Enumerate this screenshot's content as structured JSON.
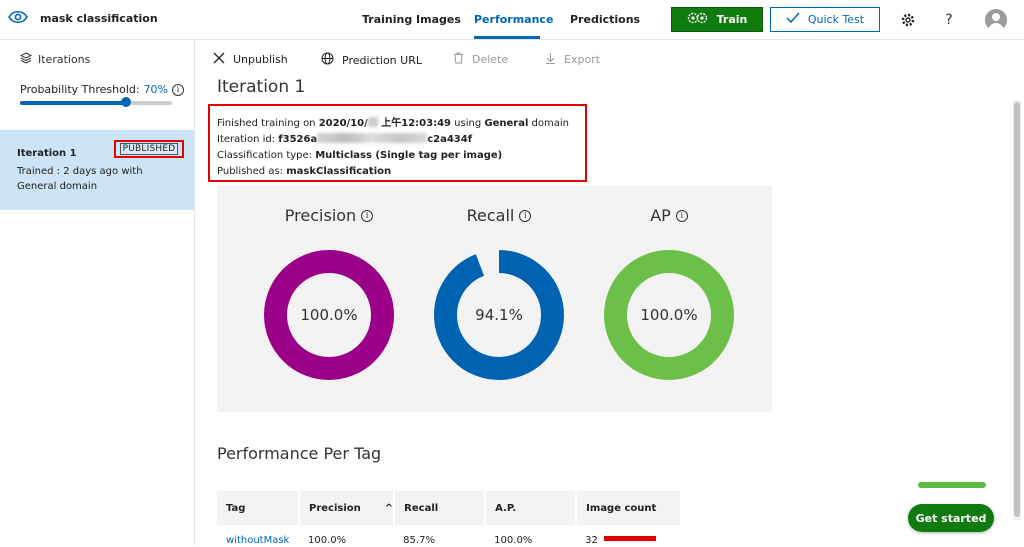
{
  "app": {
    "project_name": "mask classification"
  },
  "nav": {
    "tabs": [
      {
        "label": "Training Images"
      },
      {
        "label": "Performance"
      },
      {
        "label": "Predictions"
      }
    ],
    "active_tab": "Performance",
    "train_label": "Train",
    "quick_test_label": "Quick Test"
  },
  "sidebar": {
    "heading": "Iterations",
    "threshold_label": "Probability Threshold:",
    "threshold_value": "70%",
    "threshold_fraction": 0.7,
    "iteration": {
      "name": "Iteration 1",
      "badge": "PUBLISHED",
      "trained_line1": "Trained : 2 days ago with",
      "trained_line2": "General domain"
    }
  },
  "toolbar": {
    "unpublish": "Unpublish",
    "prediction_url": "Prediction URL",
    "delete": "Delete",
    "export": "Export"
  },
  "main": {
    "title": "Iteration 1",
    "info": {
      "finished_prefix": "Finished training on ",
      "date_start": "2020/10/",
      "date_end": " 上午12:03:49",
      "using": " using ",
      "domain": "General",
      "domain_suffix": " domain",
      "iter_id_label": "Iteration id: ",
      "iter_id_start": "f3526a",
      "iter_id_end": "c2a434f",
      "class_type_label": "Classification type: ",
      "class_type": "Multiclass (Single tag per image)",
      "published_label": "Published as: ",
      "published_name": "maskClassification"
    },
    "metrics": [
      {
        "label": "Precision",
        "value": "100.0%",
        "fraction": 1.0,
        "color": "#9b0088"
      },
      {
        "label": "Recall",
        "value": "94.1%",
        "fraction": 0.941,
        "color": "#0063b1"
      },
      {
        "label": "AP",
        "value": "100.0%",
        "fraction": 1.0,
        "color": "#6cc04a"
      }
    ],
    "perf_title": "Performance Per Tag",
    "table": {
      "headers": [
        "Tag",
        "Precision",
        "Recall",
        "A.P.",
        "Image count"
      ],
      "sort_indicator": "^",
      "rows": [
        {
          "tag": "withoutMask",
          "precision": "100.0%",
          "recall": "85.7%",
          "ap": "100.0%",
          "count": "32"
        }
      ]
    }
  },
  "footer": {
    "get_started": "Get started"
  },
  "colors": {
    "accent": "#0067b8",
    "train_green": "#107c10",
    "highlight_red": "#e00000"
  }
}
